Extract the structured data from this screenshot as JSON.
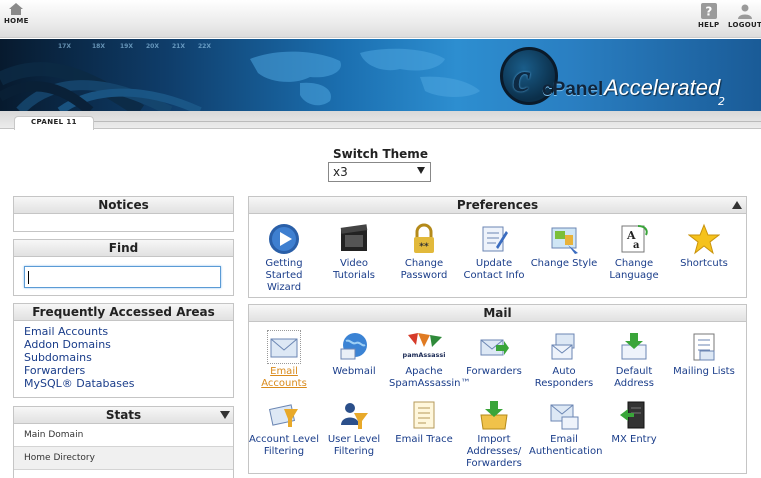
{
  "topbar": {
    "home_label": "HOME",
    "help_label": "HELP",
    "logout_label": "LOGOUT"
  },
  "banner": {
    "brand_c": "c",
    "brand_name": "cPanel",
    "brand_edition": "Accelerated",
    "brand_version": "2",
    "ticker": [
      "17X",
      "18X",
      "19X",
      "20X",
      "21X",
      "22X"
    ]
  },
  "version_tab": "CPANEL 11",
  "switch_theme": {
    "label": "Switch Theme",
    "selected": "x3"
  },
  "notices": {
    "title": "Notices"
  },
  "find": {
    "title": "Find",
    "value": ""
  },
  "faa": {
    "title": "Frequently Accessed Areas",
    "links": [
      "Email Accounts",
      "Addon Domains",
      "Subdomains",
      "Forwarders",
      "MySQL® Databases"
    ]
  },
  "stats": {
    "title": "Stats",
    "rows": [
      "Main Domain",
      "Home Directory"
    ]
  },
  "preferences": {
    "title": "Preferences",
    "items": [
      {
        "label": "Getting Started Wizard",
        "icon": "play-icon"
      },
      {
        "label": "Video Tutorials",
        "icon": "film-icon"
      },
      {
        "label": "Change Password",
        "icon": "lock-icon"
      },
      {
        "label": "Update Contact Info",
        "icon": "contact-icon"
      },
      {
        "label": "Change Style",
        "icon": "style-icon"
      },
      {
        "label": "Change Language",
        "icon": "language-icon"
      },
      {
        "label": "Shortcuts",
        "icon": "star-icon"
      }
    ]
  },
  "mail": {
    "title": "Mail",
    "items": [
      {
        "label": "Email Accounts",
        "icon": "envelope-icon"
      },
      {
        "label": "Webmail",
        "icon": "globe-mail-icon"
      },
      {
        "label": "Apache SpamAssassin™",
        "icon": "spamassassin-icon",
        "logo_text": "SpamAssassin"
      },
      {
        "label": "Forwarders",
        "icon": "forward-icon"
      },
      {
        "label": "Auto Responders",
        "icon": "autoresponder-icon"
      },
      {
        "label": "Default Address",
        "icon": "default-address-icon"
      },
      {
        "label": "Mailing Lists",
        "icon": "mailing-list-icon"
      },
      {
        "label": "Account Level Filtering",
        "icon": "filter-icon"
      },
      {
        "label": "User Level Filtering",
        "icon": "user-filter-icon"
      },
      {
        "label": "Email Trace",
        "icon": "trace-icon"
      },
      {
        "label": "Import Addresses/ Forwarders",
        "icon": "import-icon"
      },
      {
        "label": "Email Authentication",
        "icon": "auth-icon"
      },
      {
        "label": "MX Entry",
        "icon": "mx-icon"
      }
    ]
  },
  "colors": {
    "link": "#1a3d8a",
    "active_link": "#d98a1b",
    "banner_dark": "#071a2e",
    "banner_light": "#2d8ed0"
  }
}
